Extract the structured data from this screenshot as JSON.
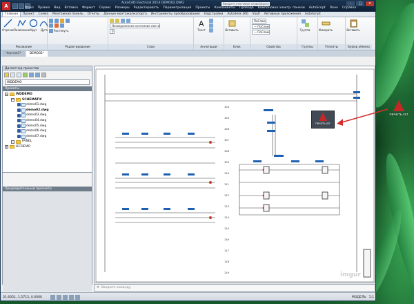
{
  "window": {
    "app_logo": "A",
    "title": "AutoCAD Electrical 2014   DEMO02.DWG",
    "search_placeholder": "Введите ключевое слово/фразу",
    "minimize": "–",
    "maximize": "□",
    "close": "×"
  },
  "menu": [
    "Файл",
    "Правка",
    "Вид",
    "Вставка",
    "Формат",
    "Сервис",
    "Размеры",
    "Редактировать",
    "Параметризация",
    "Проекты",
    "Компоненты",
    "Провода",
    "Компоновка электр. панели",
    "AutoScript",
    "Окно",
    "Справка"
  ],
  "ribbon_tabs": [
    "Главная",
    "Проект",
    "Схема",
    "Монтажная панель",
    "Отчеты",
    "Данные монтажа/экспорта",
    "Инструменты преобразования",
    "Надстройки",
    "Autodesk 360",
    "Vault",
    "Активные приложения",
    "AutoScript"
  ],
  "ribbon": {
    "drawing": {
      "title": "Рисование",
      "line": "Отрезок",
      "polyline": "Полилиния",
      "circle": "Круг",
      "arc": "Дуга"
    },
    "edit": {
      "title": "Редактирование",
      "stretch": "Растянуть"
    },
    "layers": {
      "title": "Слои",
      "state": "Несохраненное состояние листа",
      "current": "0"
    },
    "annotation": {
      "title": "Аннотации",
      "text": "Текст",
      "table": "Таблица"
    },
    "block": {
      "title": "Блок",
      "insert": "Вставить"
    },
    "properties": {
      "title": "Свойства",
      "bylayer1": "ПоСлою",
      "bylayer2": "— ПоСлою",
      "bylayer3": "— ПоСлою"
    },
    "groups": {
      "title": "Группы",
      "group": "Группа"
    },
    "utilities": {
      "title": "Утилиты",
      "measure": "Измерить"
    },
    "clipboard": {
      "title": "Буфер обмена",
      "paste": "Вставить"
    }
  },
  "doc_tabs": [
    "Чертеж1*",
    "DEMO02*"
  ],
  "project_manager": {
    "title": "Диспетчер проектов",
    "selected_project": "WDDEMO",
    "projects_header": "Проекты",
    "preview_header": "Предварительный просмотр",
    "tree": [
      {
        "label": "WDDEMO",
        "level": 0,
        "type": "root",
        "bold": true
      },
      {
        "label": "SCHEMATIC",
        "level": 1,
        "type": "folder",
        "bold": true
      },
      {
        "label": "demo01.dwg",
        "level": 2,
        "type": "dwg",
        "bold": false
      },
      {
        "label": "demo02.dwg",
        "level": 2,
        "type": "dwg",
        "bold": true
      },
      {
        "label": "demo03.dwg",
        "level": 2,
        "type": "dwg",
        "bold": false
      },
      {
        "label": "demo04.dwg",
        "level": 2,
        "type": "dwg",
        "bold": false
      },
      {
        "label": "demo05.dwg",
        "level": 2,
        "type": "dwg",
        "bold": false
      },
      {
        "label": "demo06.dwg",
        "level": 2,
        "type": "dwg",
        "bold": false
      },
      {
        "label": "demo07.dwg",
        "level": 2,
        "type": "dwg",
        "bold": false
      },
      {
        "label": "PANEL",
        "level": 1,
        "type": "folder",
        "bold": false
      },
      {
        "label": "IECDEMO",
        "level": 0,
        "type": "root",
        "bold": false
      }
    ]
  },
  "drawing": {
    "row_numbers": [
      "104",
      "105",
      "106",
      "107",
      "108",
      "109",
      "110",
      "111",
      "112",
      "113",
      "114",
      "115",
      "116",
      "117",
      "118",
      "119"
    ]
  },
  "print_tool": {
    "label": "печать.scr"
  },
  "desktop_icon": {
    "label": "печать.scr"
  },
  "command_line": {
    "placeholder": "Введите команду"
  },
  "status": {
    "coords": "31.6051, 1.5715, 0.0000",
    "model": "МОДЕЛЬ",
    "scale": "1:1"
  },
  "watermark": "imgur",
  "colors": {
    "accent": "#c62828",
    "arrow": "#d32f2f",
    "title_bar": "#1b3350"
  }
}
